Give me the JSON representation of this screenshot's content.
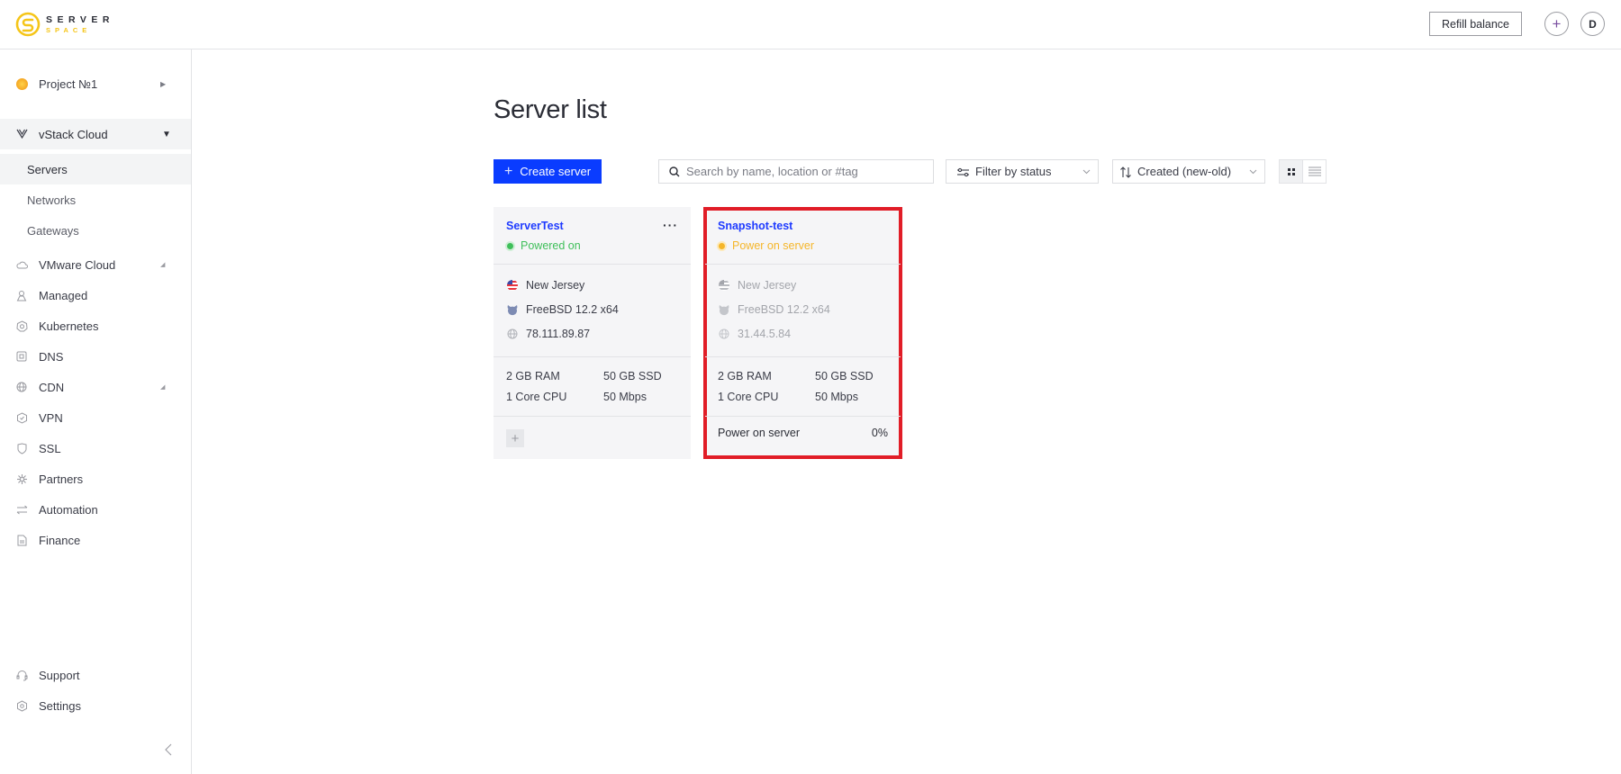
{
  "header": {
    "logo_top": "SERVER",
    "logo_bottom": "SPACE",
    "refill_label": "Refill balance",
    "add_label": "+",
    "avatar_initial": "D"
  },
  "sidebar": {
    "project": {
      "label": "Project №1",
      "icon": "project-dot-icon"
    },
    "group": {
      "label": "vStack Cloud",
      "icon": "vstack-icon",
      "expanded": true
    },
    "sub_items": [
      {
        "label": "Servers",
        "active": true
      },
      {
        "label": "Networks",
        "active": false
      },
      {
        "label": "Gateways",
        "active": false
      }
    ],
    "items": [
      {
        "label": "VMware Cloud",
        "icon": "cloud-icon",
        "has_arrow": true
      },
      {
        "label": "Managed",
        "icon": "managed-icon",
        "has_arrow": false
      },
      {
        "label": "Kubernetes",
        "icon": "kubernetes-icon",
        "has_arrow": false
      },
      {
        "label": "DNS",
        "icon": "dns-icon",
        "has_arrow": false
      },
      {
        "label": "CDN",
        "icon": "globe-icon",
        "has_arrow": true
      },
      {
        "label": "VPN",
        "icon": "vpn-icon",
        "has_arrow": false
      },
      {
        "label": "SSL",
        "icon": "shield-icon",
        "has_arrow": false
      },
      {
        "label": "Partners",
        "icon": "partners-icon",
        "has_arrow": false
      },
      {
        "label": "Automation",
        "icon": "automation-icon",
        "has_arrow": false
      },
      {
        "label": "Finance",
        "icon": "document-icon",
        "has_arrow": false
      }
    ],
    "bottom_items": [
      {
        "label": "Support",
        "icon": "headset-icon"
      },
      {
        "label": "Settings",
        "icon": "settings-icon"
      }
    ]
  },
  "main": {
    "title": "Server list",
    "create_label": "Create server",
    "search": {
      "placeholder": "Search by name, location or #tag",
      "value": ""
    },
    "filter": {
      "value": "Filter by status"
    },
    "sort": {
      "value": "Created (new-old)"
    },
    "view_mode": "grid"
  },
  "servers": [
    {
      "name": "ServerTest",
      "status": "Powered on",
      "status_color": "#3fbf5a",
      "location": "New Jersey",
      "os": "FreeBSD 12.2 x64",
      "ip": "78.111.89.87",
      "ram": "2 GB RAM",
      "disk": "50 GB SSD",
      "cpu": "1 Core CPU",
      "bandwidth": "50 Mbps",
      "menu_label": "···",
      "add_tag_label": "+"
    },
    {
      "name": "Snapshot-test",
      "status": "Power on server",
      "status_color": "#f5b62a",
      "location": "New Jersey",
      "os": "FreeBSD 12.2 x64",
      "ip": "31.44.5.84",
      "ram": "2 GB RAM",
      "disk": "50 GB SSD",
      "cpu": "1 Core CPU",
      "bandwidth": "50 Mbps",
      "progress_label": "Power on server",
      "progress_value": "0%",
      "highlighted": true,
      "highlight_color": "#e11d27"
    }
  ],
  "colors": {
    "accent": "#0a3cff",
    "link": "#1f3bff",
    "logo_yellow": "#f5c518"
  }
}
